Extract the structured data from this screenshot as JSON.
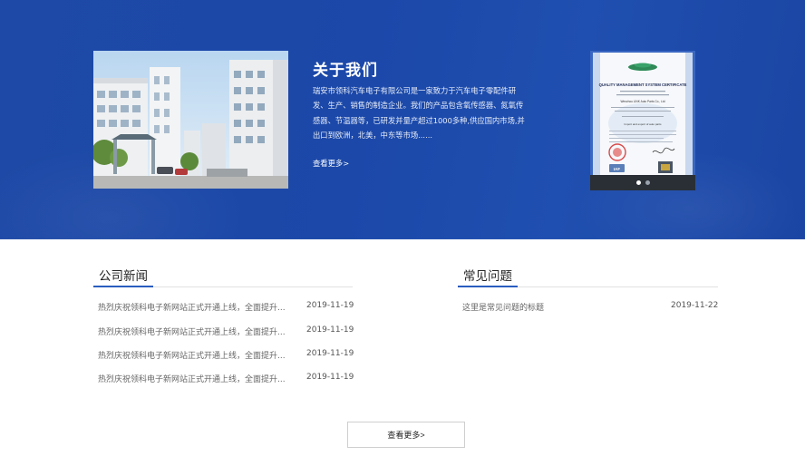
{
  "about": {
    "title": "关于我们",
    "description": "瑞安市领科汽车电子有限公司是一家致力于汽车电子零配件研发、生产、销售的制造企业。我们的产品包含氧传感器、氮氧传感器、节温器等，已研发并量产超过1000多种,供应国内市场,并出口到欧洲，北美，中东等市场......",
    "more_link": "查看更多>",
    "certificate": {
      "heading": "QUALITY MANAGEMENT SYSTEM CERTIFICATE",
      "company": "Wenzhou LINK Auto Parts Co., Ltd",
      "scope": "Import and export of auto parts",
      "accreditation": "IAF",
      "slides": 2,
      "active_slide": 1
    }
  },
  "news": {
    "title": "公司新闻",
    "items": [
      {
        "title": "热烈庆祝领科电子新网站正式开通上线，全面提升...",
        "date": "2019-11-19"
      },
      {
        "title": "热烈庆祝领科电子新网站正式开通上线，全面提升...",
        "date": "2019-11-19"
      },
      {
        "title": "热烈庆祝领科电子新网站正式开通上线，全面提升...",
        "date": "2019-11-19"
      },
      {
        "title": "热烈庆祝领科电子新网站正式开通上线，全面提升...",
        "date": "2019-11-19"
      }
    ]
  },
  "faq": {
    "title": "常见问题",
    "items": [
      {
        "title": "这里是常见问题的标题",
        "date": "2019-11-22"
      }
    ]
  },
  "more_button": "查看更多>",
  "colors": {
    "band": "#1b48a9",
    "accent": "#2a5cbf",
    "text": "#666666"
  }
}
